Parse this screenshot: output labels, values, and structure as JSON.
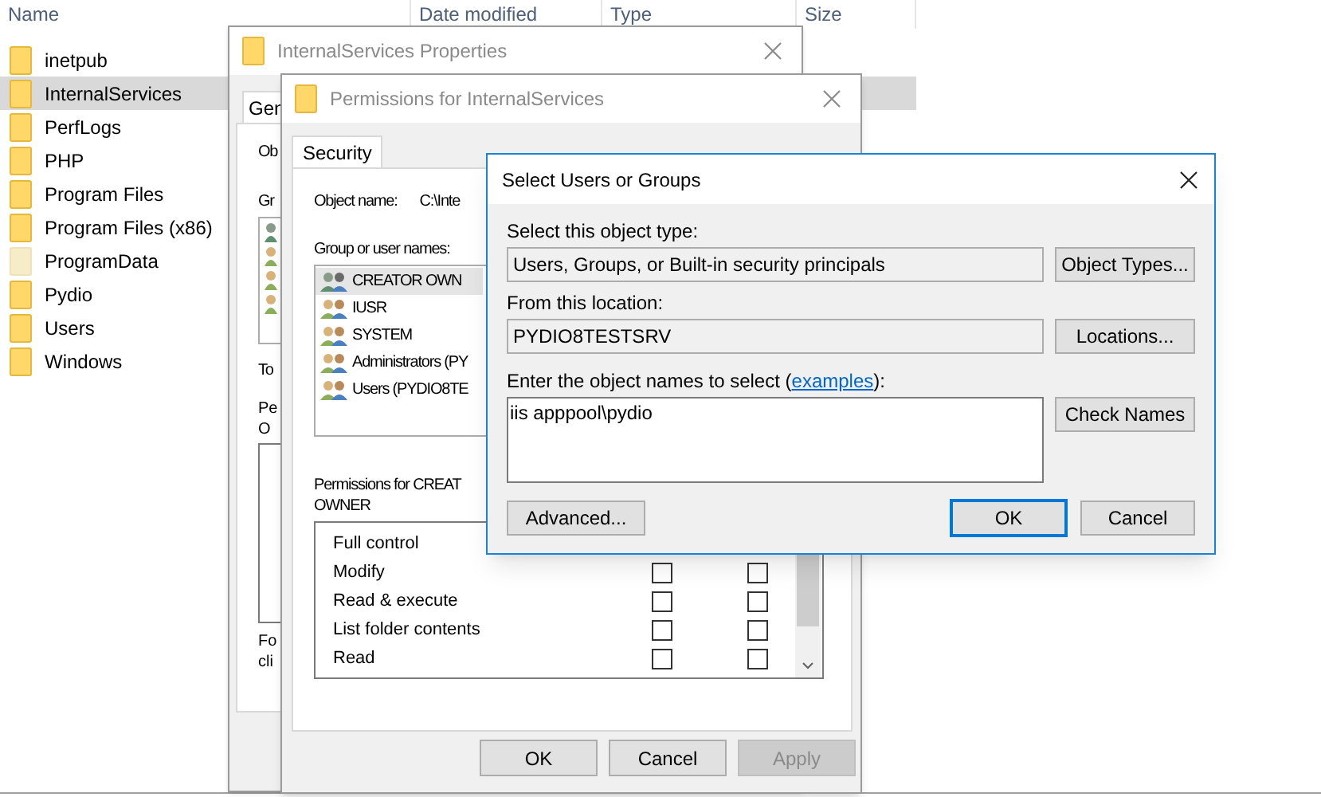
{
  "explorer": {
    "columns": [
      "Name",
      "Date modified",
      "Type",
      "Size"
    ],
    "items": [
      {
        "name": "inetpub",
        "selected": false,
        "hidden": false
      },
      {
        "name": "InternalServices",
        "selected": true,
        "hidden": false
      },
      {
        "name": "PerfLogs",
        "selected": false,
        "hidden": false
      },
      {
        "name": "PHP",
        "selected": false,
        "hidden": false
      },
      {
        "name": "Program Files",
        "selected": false,
        "hidden": false
      },
      {
        "name": "Program Files (x86)",
        "selected": false,
        "hidden": false
      },
      {
        "name": "ProgramData",
        "selected": false,
        "hidden": true
      },
      {
        "name": "Pydio",
        "selected": false,
        "hidden": false
      },
      {
        "name": "Users",
        "selected": false,
        "hidden": false
      },
      {
        "name": "Windows",
        "selected": false,
        "hidden": false
      }
    ]
  },
  "properties_window": {
    "title": "InternalServices Properties",
    "tab": "Gen",
    "object_label": "Ob",
    "group_label": "Gr",
    "tools_label": "To",
    "permissions_label": [
      "Pe",
      "O"
    ],
    "footer_text": [
      "Fo",
      "cli"
    ]
  },
  "permissions_window": {
    "title": "Permissions for InternalServices",
    "tabs": [
      {
        "label": "Security",
        "selected": true
      }
    ],
    "object_name_label": "Object name:",
    "object_name_value": "C:\\Inte",
    "group_label": "Group or user names:",
    "users": [
      {
        "name": "CREATOR OWN",
        "selected": true
      },
      {
        "name": "IUSR",
        "selected": false
      },
      {
        "name": "SYSTEM",
        "selected": false
      },
      {
        "name": "Administrators (PY",
        "selected": false
      },
      {
        "name": "Users (PYDIO8TE",
        "selected": false
      }
    ],
    "permissions_heading": [
      "Permissions for CREAT",
      "OWNER"
    ],
    "permissions": [
      {
        "name": "Full control"
      },
      {
        "name": "Modify",
        "allow": false,
        "deny": false
      },
      {
        "name": "Read & execute",
        "allow": false,
        "deny": false
      },
      {
        "name": "List folder contents",
        "allow": false,
        "deny": false
      },
      {
        "name": "Read",
        "allow": false,
        "deny": false
      }
    ],
    "buttons": [
      {
        "label": "OK",
        "disabled": false
      },
      {
        "label": "Cancel",
        "disabled": false
      },
      {
        "label": "Apply",
        "disabled": true
      }
    ]
  },
  "select_dialog": {
    "title": "Select Users or Groups",
    "object_type_label": "Select this object type:",
    "object_type_value": "Users, Groups, or Built-in security principals",
    "object_types_button": "Object Types...",
    "location_label": "From this location:",
    "location_value": "PYDIO8TESTSRV",
    "locations_button": "Locations...",
    "names_label_before": "Enter the object names to select (",
    "names_link": "examples",
    "names_label_after": "):",
    "names_value": "iis apppool\\pydio",
    "check_names_button": "Check Names",
    "advanced_button": "Advanced...",
    "ok_button": "OK",
    "cancel_button": "Cancel"
  }
}
